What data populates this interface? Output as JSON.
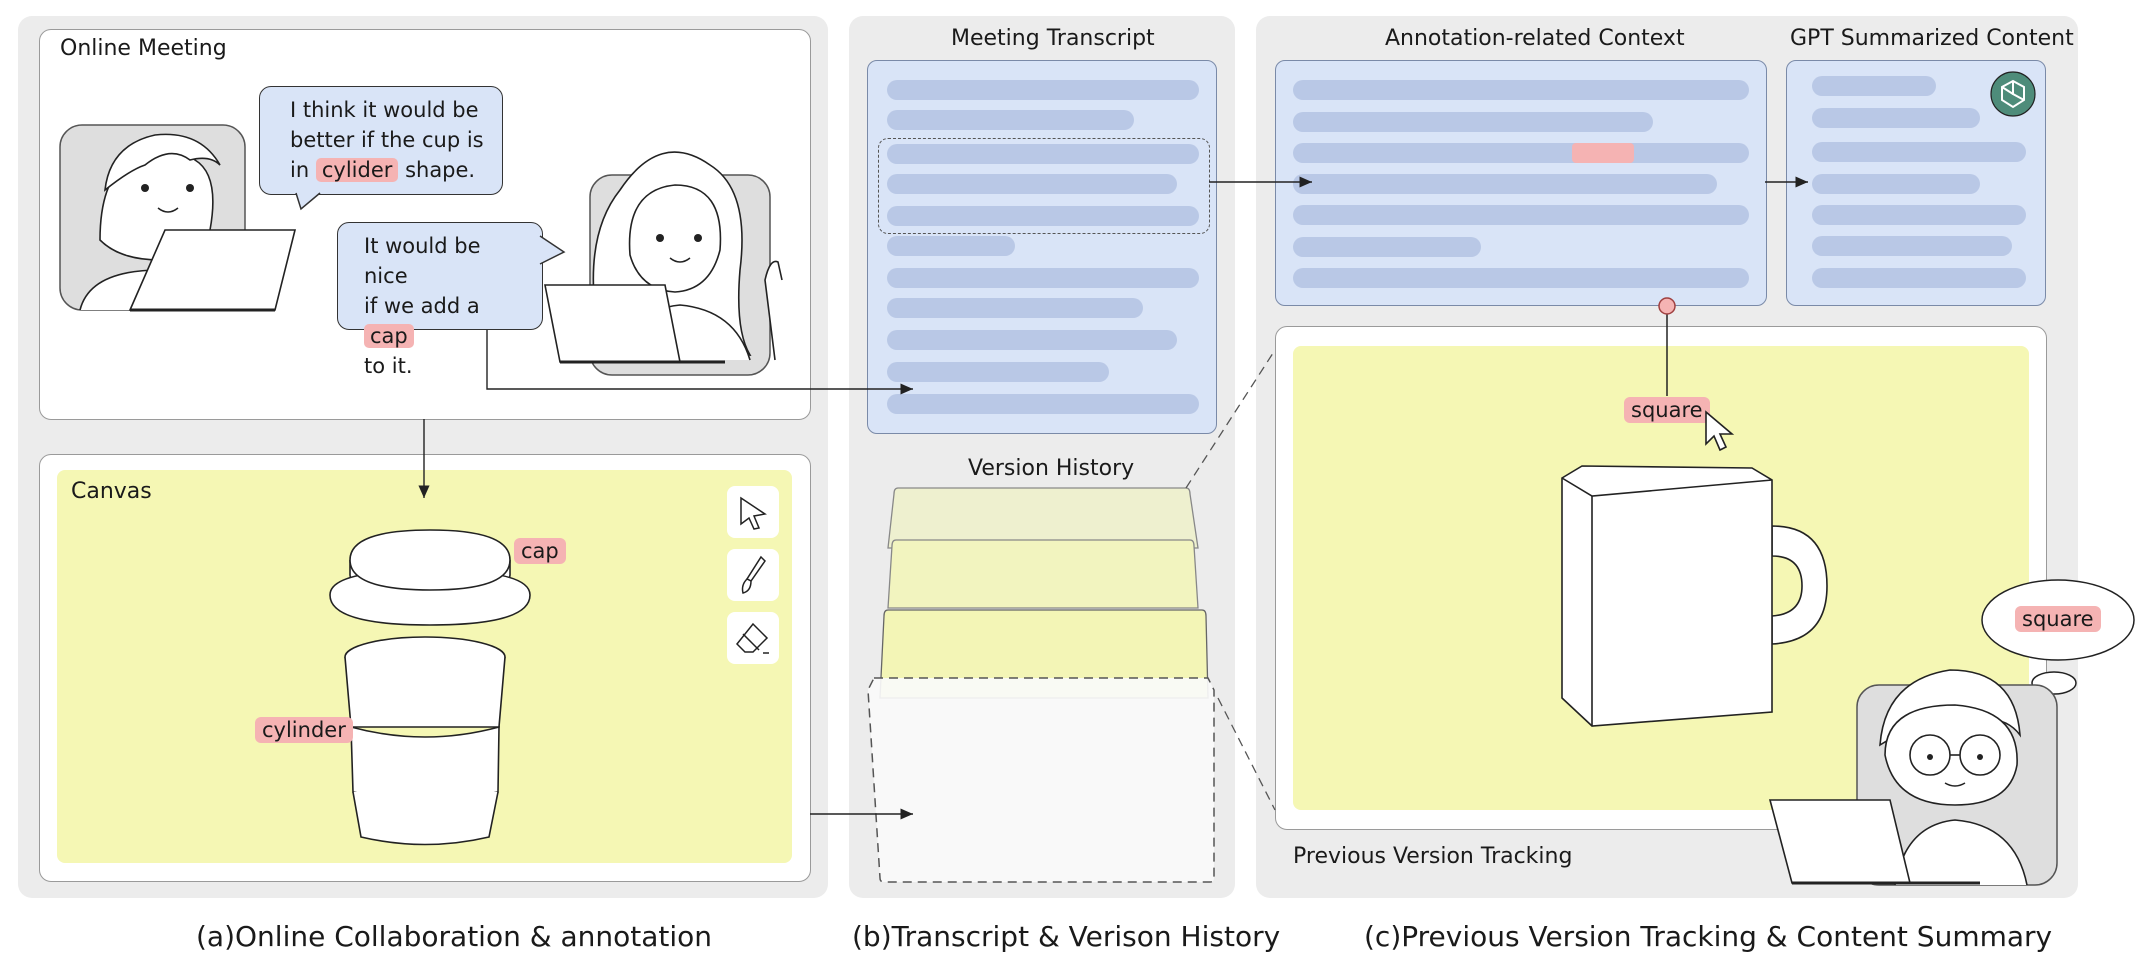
{
  "panel_a": {
    "meeting_title": "Online Meeting",
    "bubble1": {
      "line1": "I think it would be",
      "line2": "better if the cup is",
      "pre": "in",
      "highlight": "cylider",
      "post": "shape."
    },
    "bubble2": {
      "line1": "It would be nice",
      "pre": "if we add a",
      "highlight": "cap",
      "line3": "to it."
    },
    "canvas_title": "Canvas",
    "tag_cap": "cap",
    "tag_cylinder": "cylinder",
    "tools": [
      "pointer-icon",
      "brush-icon",
      "eraser-icon"
    ],
    "caption": "(a)Online Collaboration & annotation"
  },
  "panel_b": {
    "transcript_title": "Meeting Transcript",
    "version_title": "Version History",
    "caption": "(b)Transcript & Verison History"
  },
  "panel_c": {
    "context_title": "Annotation-related Context",
    "gpt_title": "GPT Summarized Content",
    "tag_square": "square",
    "thought_square": "square",
    "tracking_title": "Previous Version Tracking",
    "caption": "(c)Previous Version Tracking & Content Summary"
  },
  "colors": {
    "panel_bg": "#ececec",
    "transcript_bg": "#d9e4f7",
    "line_fill": "#b9c8e6",
    "canvas_yellow": "#f5f7b4",
    "highlight_pink": "#f5b3b3",
    "gpt_logo": "#4e8c7a"
  }
}
